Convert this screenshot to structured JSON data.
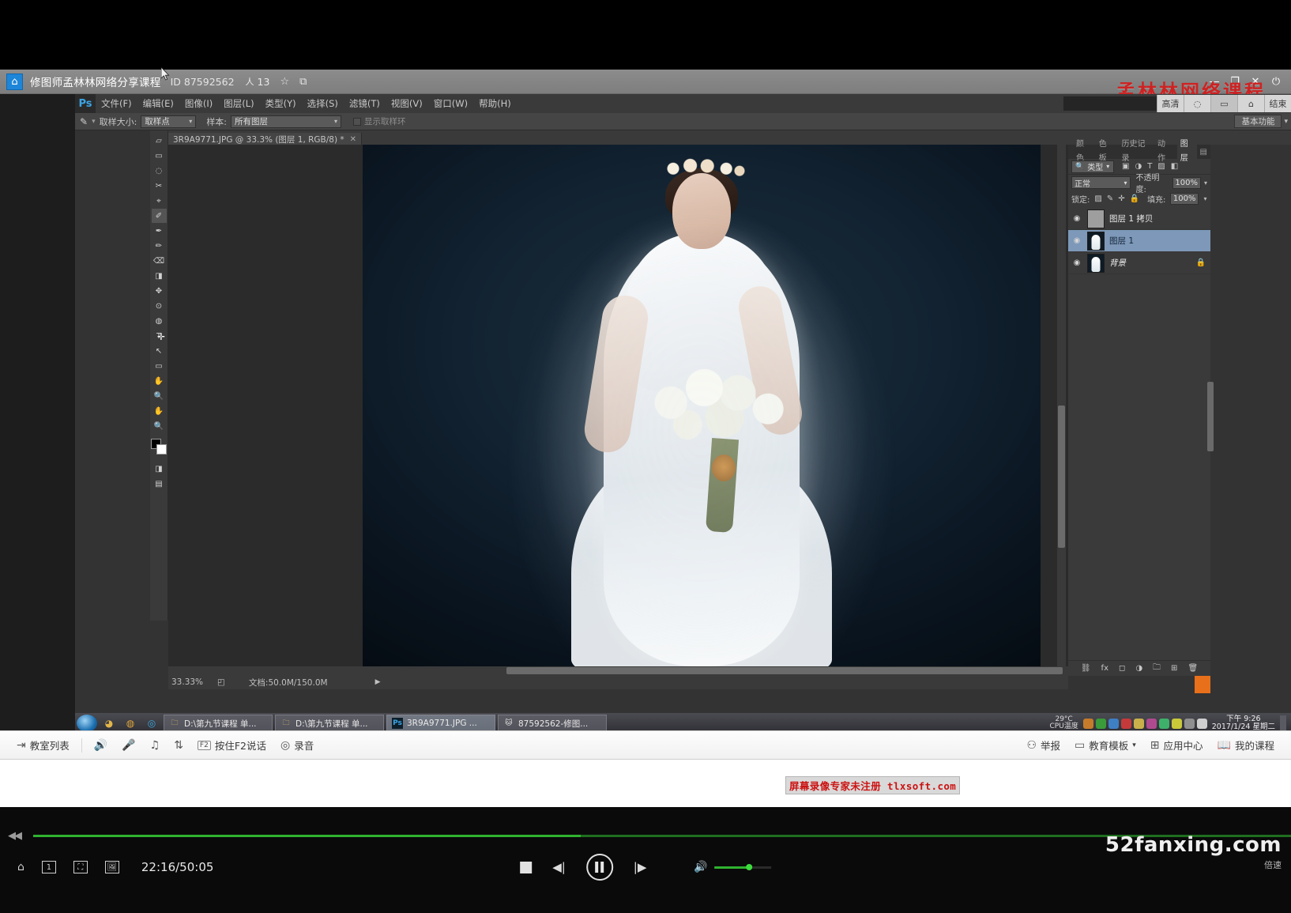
{
  "classroom": {
    "title": "修图师孟林林网络分享课程",
    "id_label": "ID",
    "id_value": "87592562",
    "member_count": "13",
    "icons": {
      "home": "⌂",
      "members": "人",
      "star": "☆",
      "share": "⧉"
    },
    "window_buttons": {
      "minimize": "—",
      "maximize": "❐",
      "close": "✕",
      "power": "⏻"
    },
    "watermark": "孟林林网络课程"
  },
  "photoshop": {
    "logo": "Ps",
    "menu": [
      "文件(F)",
      "编辑(E)",
      "图像(I)",
      "图层(L)",
      "类型(Y)",
      "选择(S)",
      "滤镜(T)",
      "视图(V)",
      "窗口(W)",
      "帮助(H)"
    ],
    "menu_right": [
      "高清",
      "◌",
      "▭",
      "⌂",
      "结束"
    ],
    "options": {
      "tool_icon": "✎",
      "sample_size_label": "取样大小:",
      "sample_size_value": "取样点",
      "sample_label": "样本:",
      "sample_value": "所有图层",
      "show_ring_label": "显示取样环",
      "workspace": "基本功能"
    },
    "tab": {
      "title": "3R9A9771.JPG @ 33.3% (图层 1, RGB/8) *",
      "close": "✕"
    },
    "tools": [
      "▱",
      "▭",
      "◌",
      "✂",
      "⌖",
      "✐",
      "✒",
      "✏",
      "⌫",
      "◨",
      "✥",
      "⊙",
      "◍",
      "T",
      "↖",
      "▭",
      "✋",
      "🔍"
    ],
    "status": {
      "zoom": "33.33%",
      "doc_icon": "◰",
      "doc_label": "文档:50.0M/150.0M",
      "arrow": "▶"
    },
    "panel_tabs": [
      "颜色",
      "色板",
      "历史记录",
      "动作",
      "图层"
    ],
    "panel_active_tab": "图层",
    "layers_panel": {
      "filter_label": "类型",
      "filter_icon": "🔍",
      "filter_toggles": [
        "▣",
        "◑",
        "T",
        "▨",
        "◧"
      ],
      "blend_mode": "正常",
      "opacity_label": "不透明度:",
      "opacity_value": "100%",
      "lock_label": "锁定:",
      "lock_icons": [
        "▨",
        "✎",
        "✛",
        "🔒"
      ],
      "fill_label": "填充:",
      "fill_value": "100%",
      "layers": [
        {
          "name": "图层 1 拷贝",
          "visible": "◉",
          "selected": false,
          "locked": false,
          "thumb": "solid"
        },
        {
          "name": "图层 1",
          "visible": "◉",
          "selected": true,
          "locked": false,
          "thumb": "image"
        },
        {
          "name": "背景",
          "visible": "◉",
          "selected": false,
          "locked": true,
          "thumb": "image",
          "lock_icon": "🔒"
        }
      ],
      "bottom_buttons": [
        "⛓",
        "fx",
        "◻",
        "◑",
        "🗀",
        "⊞",
        "🗑"
      ]
    }
  },
  "inner_taskbar": {
    "start": "⊞",
    "quick_launch": [
      "◕",
      "◍",
      "◎",
      "∞"
    ],
    "tasks": [
      {
        "label": "D:\\第九节课程 单...",
        "icon": "🗀",
        "active": false
      },
      {
        "label": "D:\\第九节课程 单...",
        "icon": "🗀",
        "active": false
      },
      {
        "label": "3R9A9771.JPG ...",
        "icon": "Ps",
        "active": true
      },
      {
        "label": "87592562-修图...",
        "icon": "🐱",
        "active": false
      }
    ],
    "cpu_temp_line1": "29°C",
    "cpu_temp_line2": "CPU温度",
    "clock_time": "下午 9:26",
    "clock_date": "2017/1/24 星期二"
  },
  "course_toolbar": {
    "left": [
      {
        "label": "教室列表",
        "icon": "⇥"
      }
    ],
    "middle": [
      {
        "label": "",
        "icon": "🔊"
      },
      {
        "label": "",
        "icon": "🎤"
      },
      {
        "label": "",
        "icon": "♫"
      },
      {
        "label": "",
        "icon": "⇅"
      },
      {
        "label": "按住F2说话",
        "icon": "F2"
      },
      {
        "label": "录音",
        "icon": "◎"
      }
    ],
    "right": [
      {
        "label": "举报",
        "icon": "⚇"
      },
      {
        "label": "教育模板",
        "icon": "▭",
        "caret": "▾"
      },
      {
        "label": "应用中心",
        "icon": "⊞"
      },
      {
        "label": "我的课程",
        "icon": "📖"
      }
    ]
  },
  "player": {
    "current_time": "22:16",
    "total_time": "50:05",
    "time_display": "22:16/50:05",
    "progress_percent": 44,
    "volume_percent": 58,
    "left_icons": [
      "⌂",
      "1",
      "⛶",
      "🖼"
    ],
    "rewind_icon": "◀◀",
    "controls": {
      "stop": "■",
      "prev": "◀|",
      "pause": "❚❚",
      "next": "|▶",
      "volume": "🔊"
    },
    "site_watermark": "52fanxing.com",
    "site_sub": "倍速"
  },
  "recorder_watermark": {
    "text_cn": "屏幕录像专家未注册",
    "text_url": "tlxsoft.com"
  },
  "colors": {
    "accent_green": "#2fb32f",
    "selection_blue": "#7d98b8",
    "watermark_red": "#ce2222",
    "ps_panel": "#3a3a3a"
  }
}
